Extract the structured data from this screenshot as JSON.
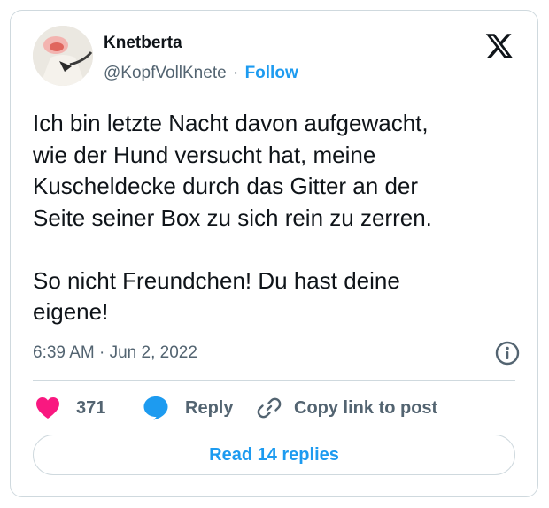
{
  "tweet": {
    "author": {
      "display_name": "Knetberta",
      "handle": "@KopfVollKnete",
      "separator": "·",
      "follow_label": "Follow"
    },
    "text": "Ich bin letzte Nacht davon aufgewacht,\nwie der Hund versucht hat, meine\nKuscheldecke durch das Gitter an der\nSeite seiner Box zu sich rein zu zerren.\n\nSo nicht Freundchen! Du hast deine\neigene!",
    "timestamp": "6:39 AM · Jun 2, 2022",
    "actions": {
      "like_count": "371",
      "reply_label": "Reply",
      "copy_label": "Copy link to post"
    },
    "read_replies_label": "Read 14 replies"
  },
  "icons": {
    "brand": "x-logo-icon",
    "info": "info-icon",
    "like": "heart-icon",
    "reply": "speech-bubble-icon",
    "copy": "link-icon"
  },
  "colors": {
    "accent": "#1d9bf0",
    "like": "#f91880",
    "text": "#0f1419",
    "muted": "#536471",
    "border": "#cfd9de"
  }
}
